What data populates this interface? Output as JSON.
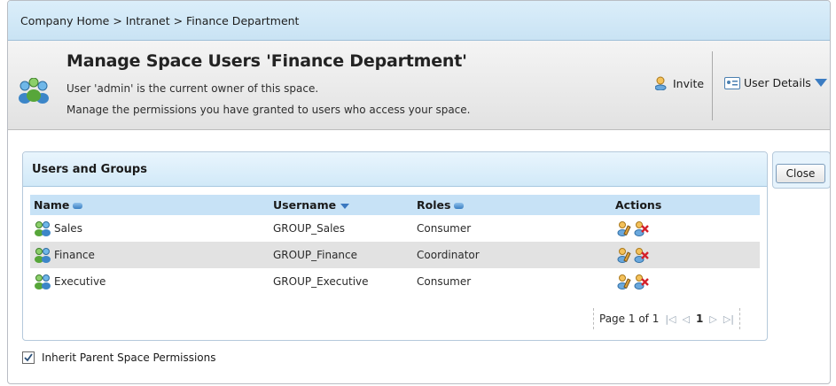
{
  "breadcrumb": "Company Home > Intranet > Finance Department",
  "header": {
    "title": "Manage Space Users 'Finance Department'",
    "owner_line": "User 'admin' is the current owner of this space.",
    "desc_line": "Manage the permissions you have granted to users who access your space.",
    "invite_label": "Invite",
    "user_details_label": "User Details"
  },
  "panel": {
    "title": "Users and Groups",
    "columns": {
      "name": "Name",
      "username": "Username",
      "roles": "Roles",
      "actions": "Actions"
    },
    "rows": [
      {
        "name": "Sales",
        "username": "GROUP_Sales",
        "role": "Consumer"
      },
      {
        "name": "Finance",
        "username": "GROUP_Finance",
        "role": "Coordinator"
      },
      {
        "name": "Executive",
        "username": "GROUP_Executive",
        "role": "Consumer"
      }
    ],
    "pager": {
      "label": "Page 1 of 1",
      "current": "1"
    }
  },
  "close_label": "Close",
  "inherit_label": "Inherit Parent Space Permissions",
  "inherit_checked": true,
  "colors": {
    "header_blue": "#c9e3f4",
    "column_header": "#c7e2f6",
    "alt_row": "#e2e2e2",
    "sort_icon": "#3a7fc2"
  }
}
